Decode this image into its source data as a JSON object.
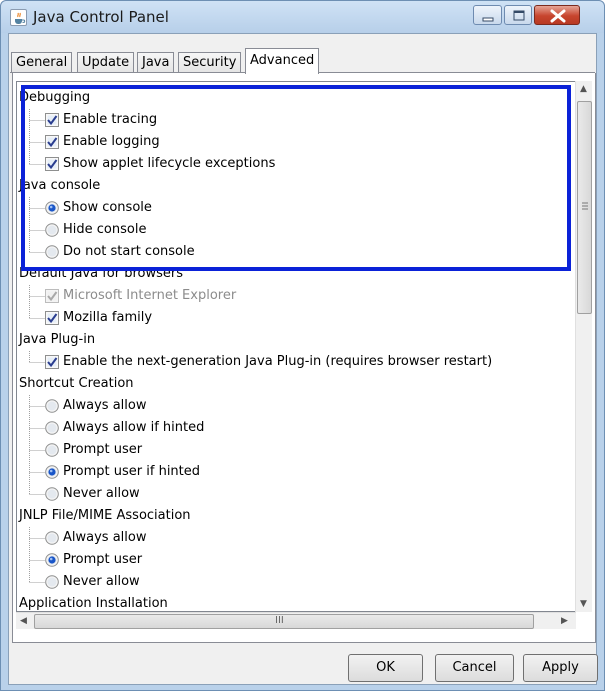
{
  "window": {
    "title": "Java Control Panel",
    "icon": "java-cup-icon"
  },
  "tabs": [
    {
      "label": "General",
      "active": false
    },
    {
      "label": "Update",
      "active": false
    },
    {
      "label": "Java",
      "active": false
    },
    {
      "label": "Security",
      "active": false
    },
    {
      "label": "Advanced",
      "active": true
    }
  ],
  "settings": [
    {
      "kind": "header",
      "label": "Debugging"
    },
    {
      "kind": "checkbox",
      "label": "Enable tracing",
      "checked": true,
      "enabled": true
    },
    {
      "kind": "checkbox",
      "label": "Enable logging",
      "checked": true,
      "enabled": true
    },
    {
      "kind": "checkbox",
      "label": "Show applet lifecycle exceptions",
      "checked": true,
      "enabled": true
    },
    {
      "kind": "header",
      "label": "Java console"
    },
    {
      "kind": "radio",
      "label": "Show console",
      "checked": true,
      "enabled": true
    },
    {
      "kind": "radio",
      "label": "Hide console",
      "checked": false,
      "enabled": true
    },
    {
      "kind": "radio",
      "label": "Do not start console",
      "checked": false,
      "enabled": true
    },
    {
      "kind": "header",
      "label": "Default Java for browsers"
    },
    {
      "kind": "checkbox",
      "label": "Microsoft Internet Explorer",
      "checked": true,
      "enabled": false
    },
    {
      "kind": "checkbox",
      "label": "Mozilla family",
      "checked": true,
      "enabled": true
    },
    {
      "kind": "header",
      "label": "Java Plug-in"
    },
    {
      "kind": "checkbox",
      "label": "Enable the next-generation Java Plug-in (requires browser restart)",
      "checked": true,
      "enabled": true
    },
    {
      "kind": "header",
      "label": "Shortcut Creation"
    },
    {
      "kind": "radio",
      "label": "Always allow",
      "checked": false,
      "enabled": true
    },
    {
      "kind": "radio",
      "label": "Always allow if hinted",
      "checked": false,
      "enabled": true
    },
    {
      "kind": "radio",
      "label": "Prompt user",
      "checked": false,
      "enabled": true
    },
    {
      "kind": "radio",
      "label": "Prompt user if hinted",
      "checked": true,
      "enabled": true
    },
    {
      "kind": "radio",
      "label": "Never allow",
      "checked": false,
      "enabled": true
    },
    {
      "kind": "header",
      "label": "JNLP File/MIME Association"
    },
    {
      "kind": "radio",
      "label": "Always allow",
      "checked": false,
      "enabled": true
    },
    {
      "kind": "radio",
      "label": "Prompt user",
      "checked": true,
      "enabled": true
    },
    {
      "kind": "radio",
      "label": "Never allow",
      "checked": false,
      "enabled": true
    },
    {
      "kind": "header",
      "label": "Application Installation"
    }
  ],
  "buttons": {
    "ok": "OK",
    "cancel": "Cancel",
    "apply": "Apply"
  },
  "scrollbar": {
    "grip": "III"
  },
  "colors": {
    "highlight_border": "#0b22d8",
    "radio_selected": "#1a56c8",
    "checkmark": "#2a3d8f",
    "close_button": "#c7452e"
  }
}
